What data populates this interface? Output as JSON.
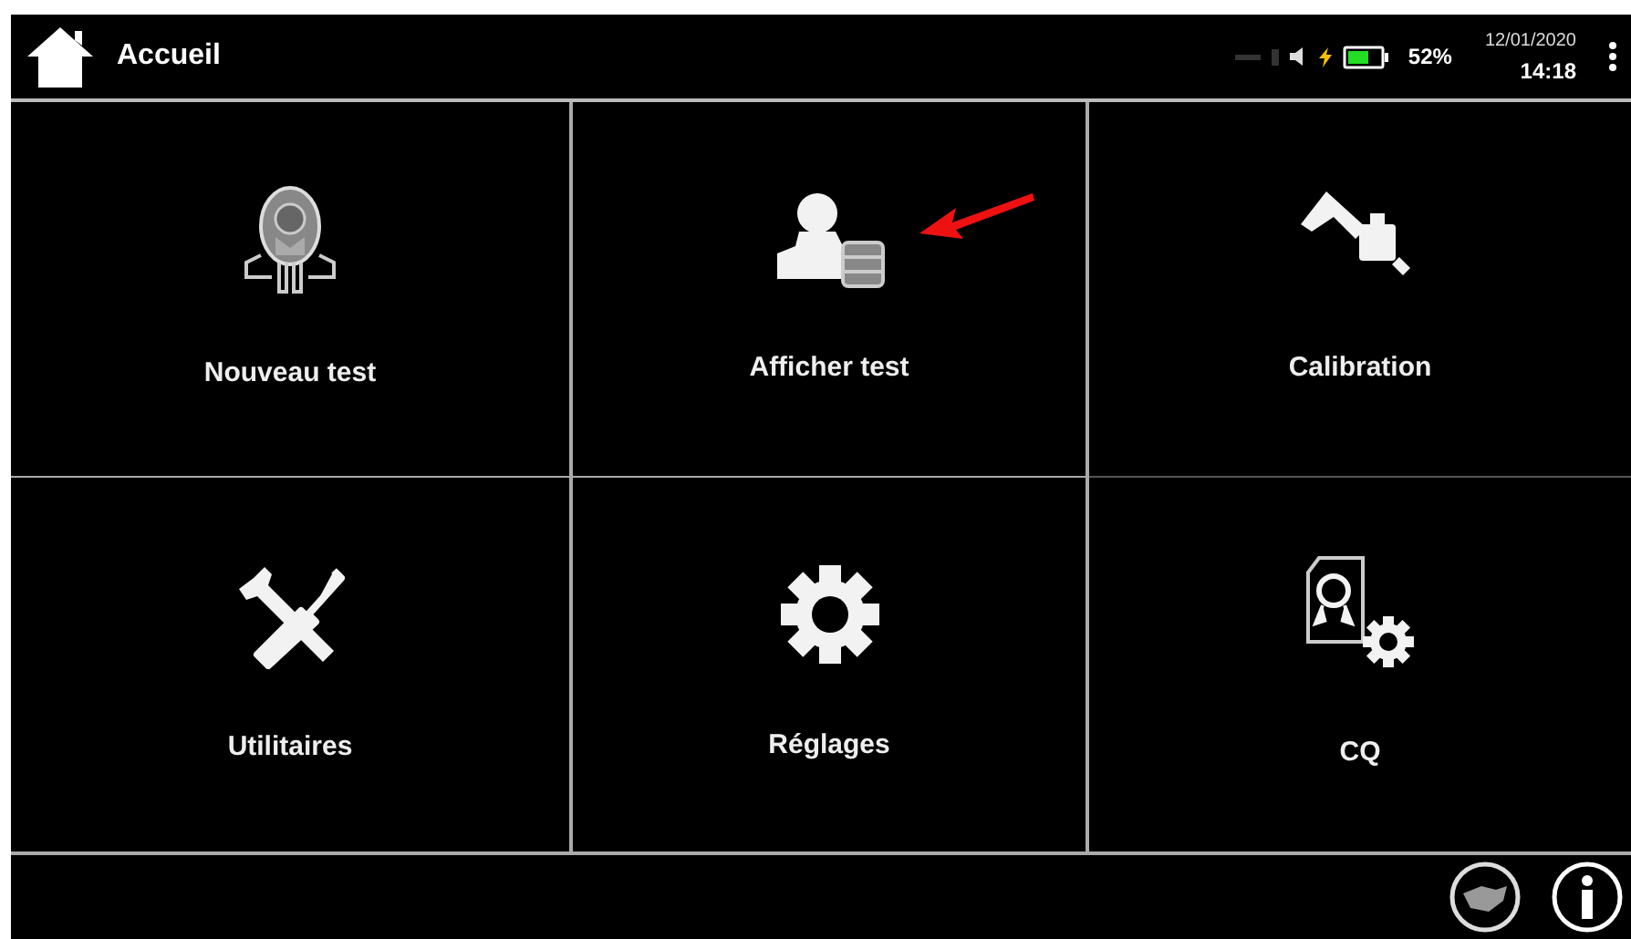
{
  "header": {
    "title": "Accueil",
    "battery": "52%",
    "date": "12/01/2020",
    "time": "14:18"
  },
  "tiles": [
    {
      "label": "Nouveau test"
    },
    {
      "label": "Afficher test",
      "annotated": true
    },
    {
      "label": "Calibration"
    },
    {
      "label": "Utilitaires"
    },
    {
      "label": "Réglages"
    },
    {
      "label": "CQ"
    }
  ]
}
